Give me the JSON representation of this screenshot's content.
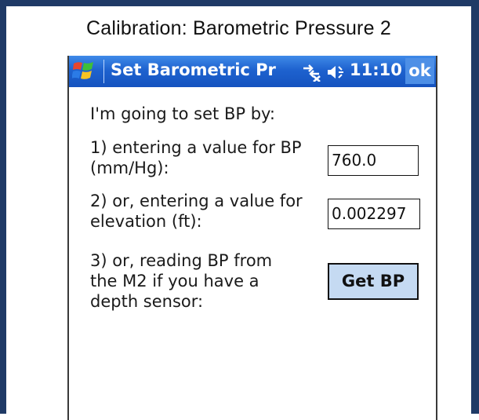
{
  "caption": "Calibration: Barometric Pressure 2",
  "titlebar": {
    "title": "Set Barometric Pr",
    "time": "11:10",
    "ok_label": "ok",
    "colors": {
      "bar": "#1e62cf",
      "ok": "#4d8fe6"
    }
  },
  "content": {
    "intro": "I'm going to set BP by:",
    "option1_label": "1) entering a value for BP\n(mm/Hg):",
    "option1_value": "760.0",
    "option2_label": "2) or, entering a value for\nelevation (ft):",
    "option2_value": "0.002297",
    "option3_label": "3) or, reading BP from\nthe M2 if you have a\ndepth sensor:",
    "get_bp_label": "Get BP"
  },
  "icons": {
    "start": "windows-logo-icon",
    "connectivity": "connectivity-icon",
    "volume": "volume-icon"
  },
  "theme": {
    "frame_border": "#1f3a66",
    "button_fill": "#c5daf2"
  }
}
